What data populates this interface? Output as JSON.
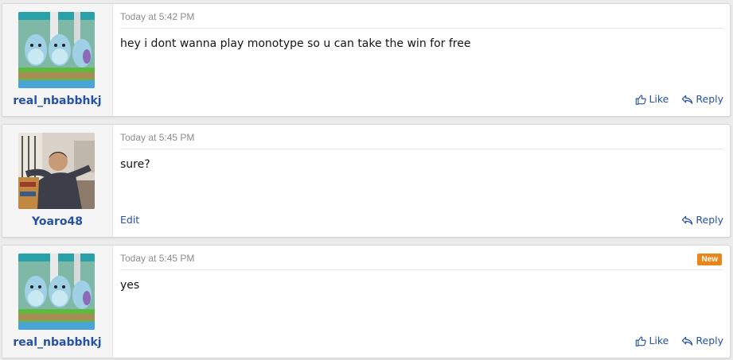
{
  "colors": {
    "link": "#2551a6",
    "timestamp": "#8c8c8c",
    "badge_bg": "#e8861a"
  },
  "posts": [
    {
      "username": "real_nbabbhkj",
      "avatar": "pokemon-quagsire-avatar",
      "timestamp": "Today at 5:42 PM",
      "message": "hey i dont wanna play monotype so u can take the win for free",
      "like_label": "Like",
      "reply_label": "Reply"
    },
    {
      "username": "Yoaro48",
      "avatar": "man-on-couch-avatar",
      "timestamp": "Today at 5:45 PM",
      "message": "sure?",
      "edit_label": "Edit",
      "reply_label": "Reply"
    },
    {
      "username": "real_nbabbhkj",
      "avatar": "pokemon-quagsire-avatar",
      "timestamp": "Today at 5:45 PM",
      "message": "yes",
      "badge": "New",
      "like_label": "Like",
      "reply_label": "Reply"
    }
  ]
}
